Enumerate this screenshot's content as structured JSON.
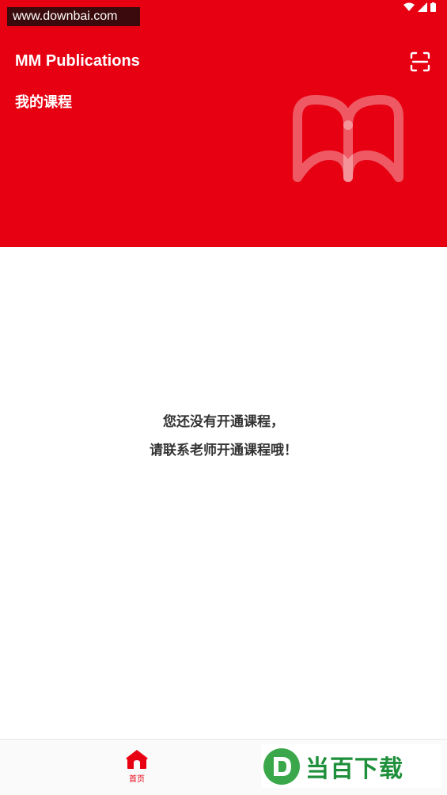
{
  "watermark_top": "www.downbai.com",
  "header": {
    "app_title": "MM Publications",
    "section_title": "我的课程"
  },
  "icons": {
    "scan": "scan-icon",
    "book": "book-icon",
    "home": "home-icon"
  },
  "empty_state": {
    "line1": "您还没有开通课程，",
    "line2": "请联系老师开通课程哦！"
  },
  "bottom_nav": {
    "home_label": "首页"
  },
  "watermark_bottom": "当百下载",
  "colors": {
    "brand_red": "#e60012",
    "text_dark": "#333333"
  }
}
